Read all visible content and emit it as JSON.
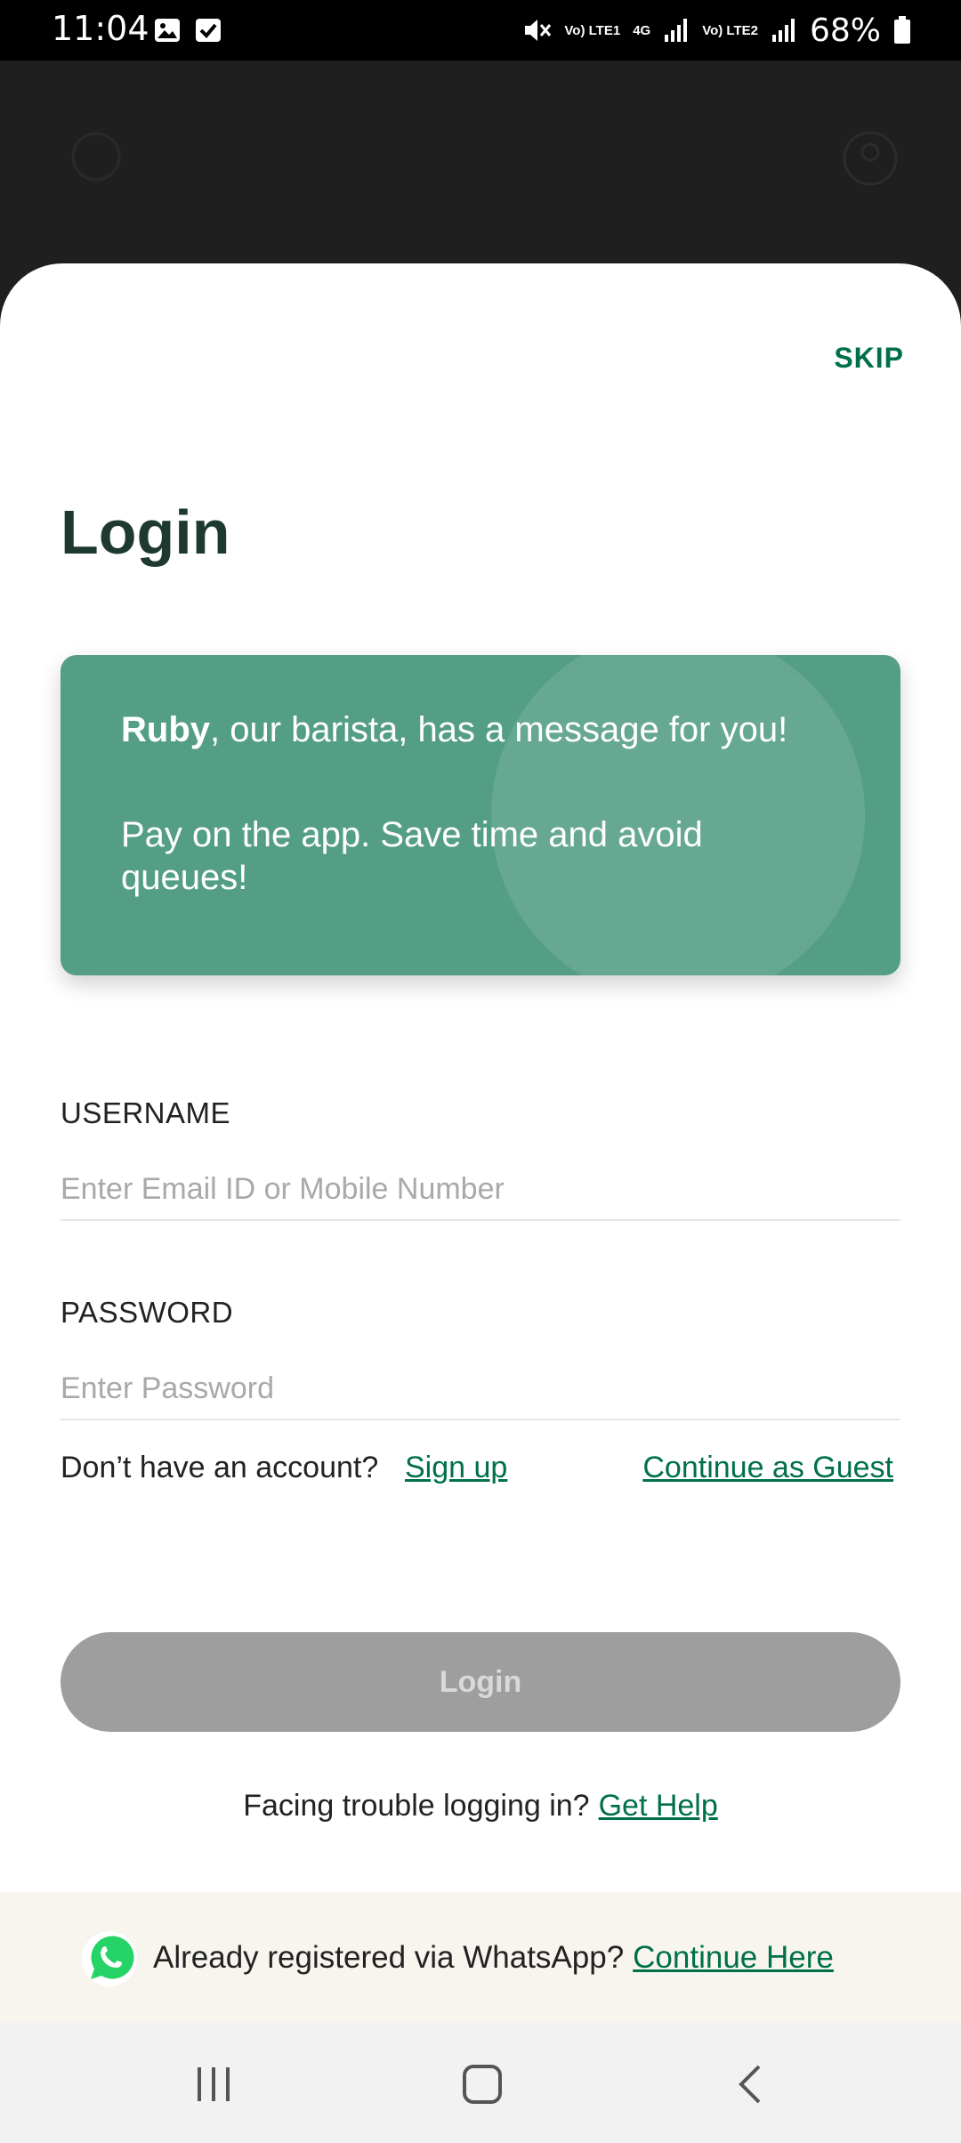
{
  "status_bar": {
    "time": "11:04",
    "network_lte1": "Vo) LTE1",
    "network_4g": "4G",
    "network_lte2": "Vo) LTE2",
    "battery": "68%"
  },
  "sheet": {
    "skip_label": "SKIP",
    "title": "Login"
  },
  "message_card": {
    "name": "Ruby",
    "line1_rest": ", our barista, has a message for you!",
    "line2": "Pay on the app. Save time and avoid queues!",
    "background": "#559e86"
  },
  "form": {
    "username_label": "USERNAME",
    "username_placeholder": "Enter Email ID or Mobile Number",
    "username_value": "",
    "password_label": "PASSWORD",
    "password_placeholder": "Enter Password",
    "password_value": ""
  },
  "account_row": {
    "question": "Don’t have an account?",
    "signup_link": "Sign up",
    "guest_link": "Continue as Guest"
  },
  "login_button": {
    "label": "Login",
    "state": "disabled"
  },
  "help": {
    "question": "Facing trouble logging in?",
    "link": "Get Help"
  },
  "whatsapp_bar": {
    "icon": "whatsapp-icon",
    "text": "Already registered via WhatsApp?",
    "link": "Continue Here"
  },
  "colors": {
    "brand_green": "#00704a",
    "title_dark": "#1e3932",
    "disabled_button": "#9e9e9e"
  },
  "nav_bar": {
    "recents_icon": "recents-icon",
    "home_icon": "home-icon",
    "back_icon": "back-icon"
  }
}
